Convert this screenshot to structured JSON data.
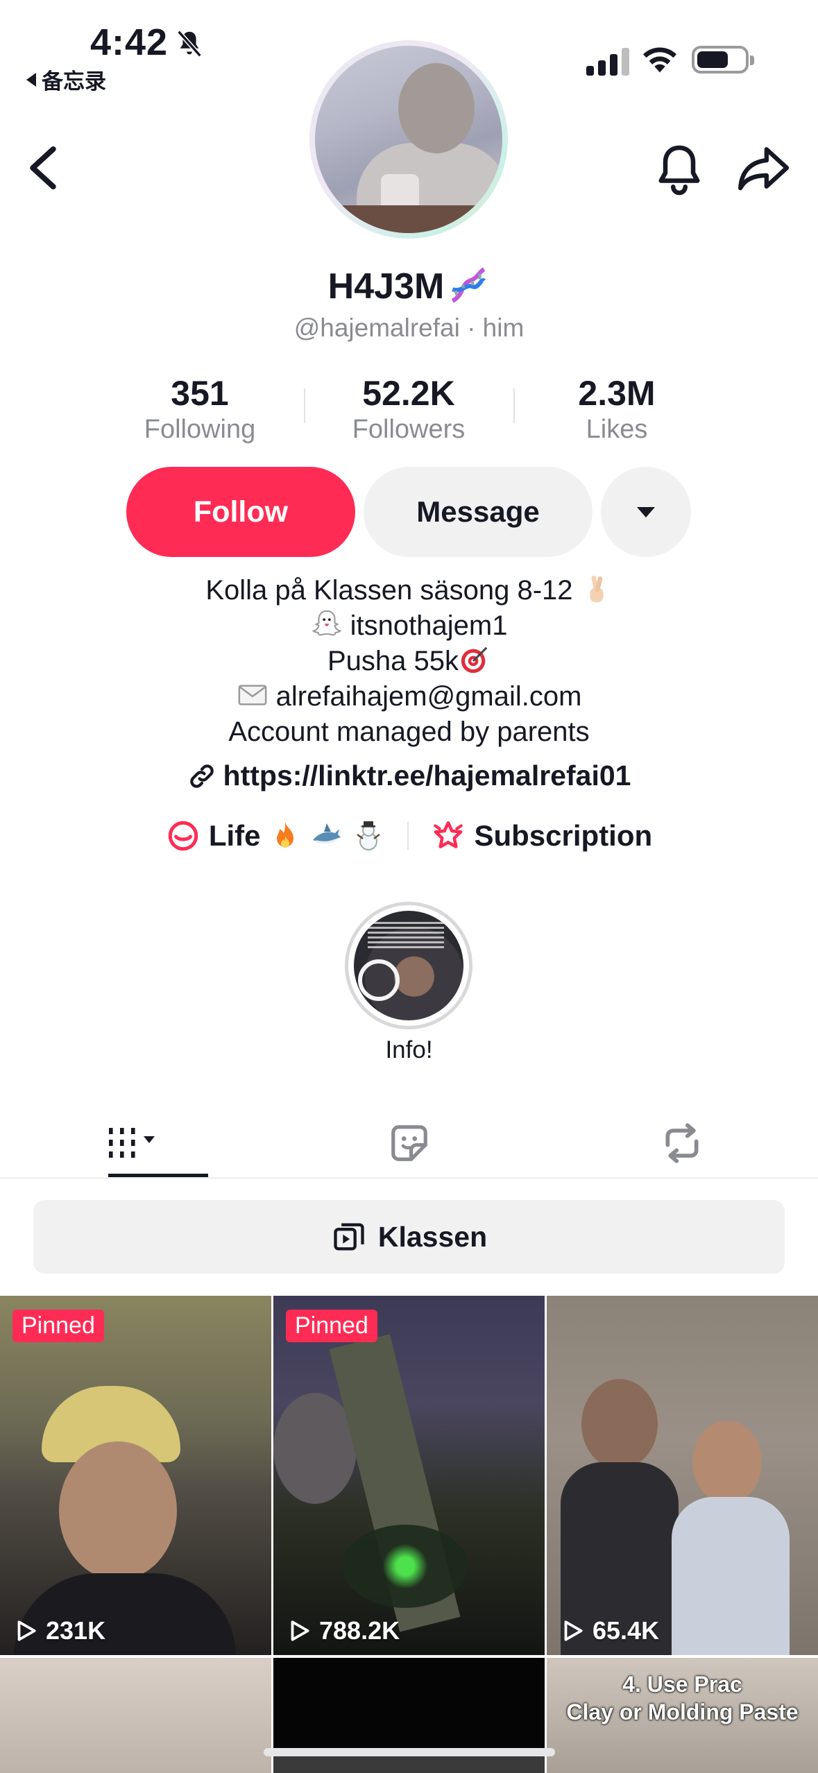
{
  "status_bar": {
    "time": "4:42",
    "back_app": "备忘录"
  },
  "profile": {
    "display_name": "H4J3M",
    "handle": "@hajemalrefai · him"
  },
  "stats": [
    {
      "value": "351",
      "label": "Following"
    },
    {
      "value": "52.2K",
      "label": "Followers"
    },
    {
      "value": "2.3M",
      "label": "Likes"
    }
  ],
  "actions": {
    "follow": "Follow",
    "message": "Message"
  },
  "bio": {
    "line1": "Kolla på Klassen säsong 8-12",
    "line2": "itsnothajem1",
    "line3": "Pusha 55k",
    "line4": "alrefaihajem@gmail.com",
    "line5": "Account managed by parents",
    "link": "https://linktr.ee/hajemalrefai01"
  },
  "chips": {
    "life_label": "Life",
    "subscription_label": "Subscription"
  },
  "highlight": {
    "label": "Info!"
  },
  "collection": {
    "label": "Klassen"
  },
  "videos": [
    {
      "pinned": "Pinned",
      "views": "231K"
    },
    {
      "pinned": "Pinned",
      "views": "788.2K"
    },
    {
      "views": "65.4K"
    },
    {},
    {},
    {
      "overlay_line1": "4. Use Prac",
      "overlay_line2": "Clay or Molding Paste"
    }
  ],
  "colors": {
    "accent": "#fe2c55",
    "secondary_button": "#f1f1f2",
    "muted_text": "#8a8b91"
  },
  "icons": [
    "bell-off-icon",
    "chevron-left-icon",
    "bell-icon",
    "share-icon",
    "dna-icon",
    "link-icon",
    "lemon8-icon",
    "subscription-star-icon",
    "videos-grid-icon",
    "favorites-icon",
    "repost-icon",
    "playlist-icon",
    "play-icon"
  ]
}
